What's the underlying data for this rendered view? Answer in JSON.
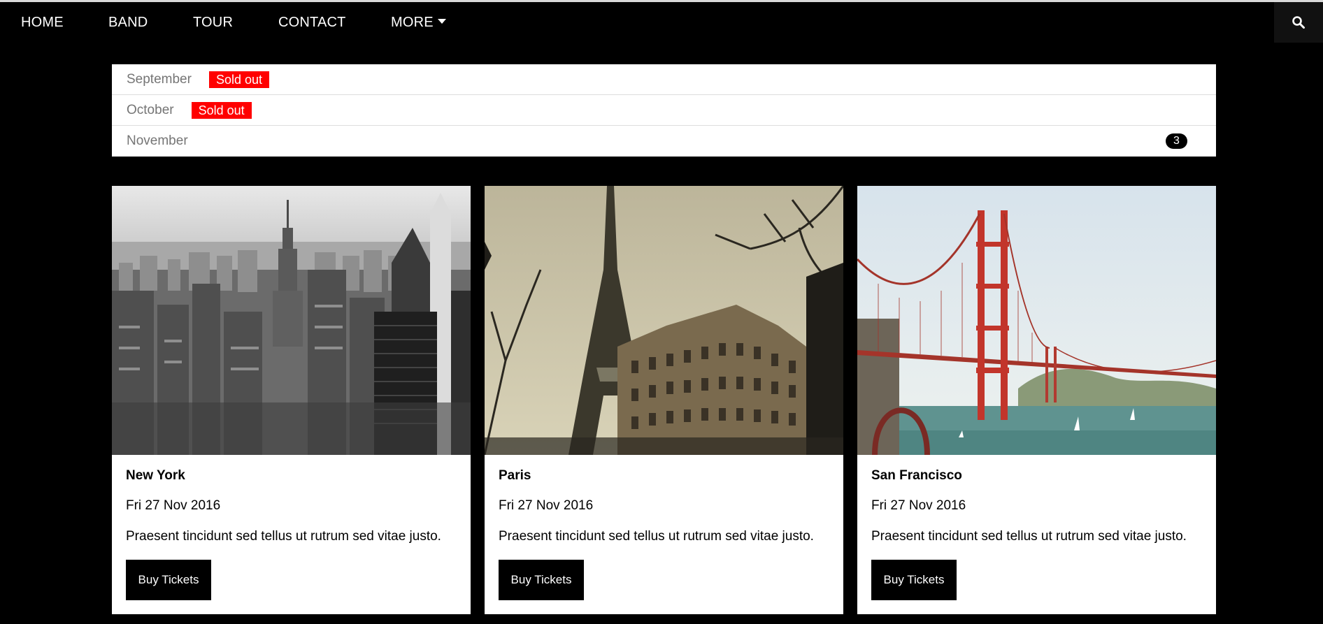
{
  "nav": {
    "items": [
      {
        "label": "HOME"
      },
      {
        "label": "BAND"
      },
      {
        "label": "TOUR"
      },
      {
        "label": "CONTACT"
      },
      {
        "label": "MORE"
      }
    ],
    "icons": {
      "more": "caret-down-icon",
      "search": "search-icon"
    }
  },
  "months": [
    {
      "label": "September",
      "badge": "Sold out"
    },
    {
      "label": "October",
      "badge": "Sold out"
    },
    {
      "label": "November",
      "count": "3"
    }
  ],
  "cards": [
    {
      "city": "New York",
      "date": "Fri 27 Nov 2016",
      "description": "Praesent tincidunt sed tellus ut rutrum sed vitae justo.",
      "button": "Buy Tickets"
    },
    {
      "city": "Paris",
      "date": "Fri 27 Nov 2016",
      "description": "Praesent tincidunt sed tellus ut rutrum sed vitae justo.",
      "button": "Buy Tickets"
    },
    {
      "city": "San Francisco",
      "date": "Fri 27 Nov 2016",
      "description": "Praesent tincidunt sed tellus ut rutrum sed vitae justo.",
      "button": "Buy Tickets"
    }
  ],
  "colors": {
    "background": "#000000",
    "sold_out": "#ff0000",
    "card": "#ffffff",
    "muted_text": "#757575"
  }
}
